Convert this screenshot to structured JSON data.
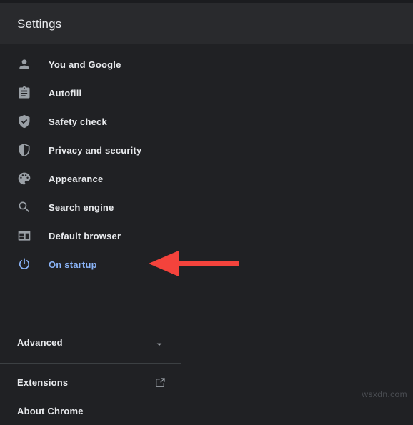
{
  "window": {
    "background_color": "#202124",
    "header_background_color": "#292a2d"
  },
  "header": {
    "title": "Settings"
  },
  "sidebar": {
    "items": [
      {
        "label": "You and Google",
        "icon": "person-icon",
        "selected": false
      },
      {
        "label": "Autofill",
        "icon": "clipboard-icon",
        "selected": false
      },
      {
        "label": "Safety check",
        "icon": "shield-check-icon",
        "selected": false
      },
      {
        "label": "Privacy and security",
        "icon": "shield-icon",
        "selected": false
      },
      {
        "label": "Appearance",
        "icon": "palette-icon",
        "selected": false
      },
      {
        "label": "Search engine",
        "icon": "search-icon",
        "selected": false
      },
      {
        "label": "Default browser",
        "icon": "browser-window-icon",
        "selected": false
      },
      {
        "label": "On startup",
        "icon": "power-icon",
        "selected": true
      }
    ],
    "advanced": {
      "label": "Advanced",
      "icon": "chevron-down-icon"
    },
    "links": [
      {
        "label": "Extensions",
        "icon": "external-link-icon"
      },
      {
        "label": "About Chrome",
        "icon": ""
      }
    ],
    "selected_color": "#8ab4f8",
    "icon_color": "#9aa0a6",
    "text_color": "#e8eaed"
  },
  "annotation": {
    "arrow": {
      "shape": "left-pointing-arrow",
      "color": "#f44336",
      "direction": "left",
      "points_to": "On startup"
    }
  },
  "watermark": {
    "text": "wsxdn.com"
  }
}
